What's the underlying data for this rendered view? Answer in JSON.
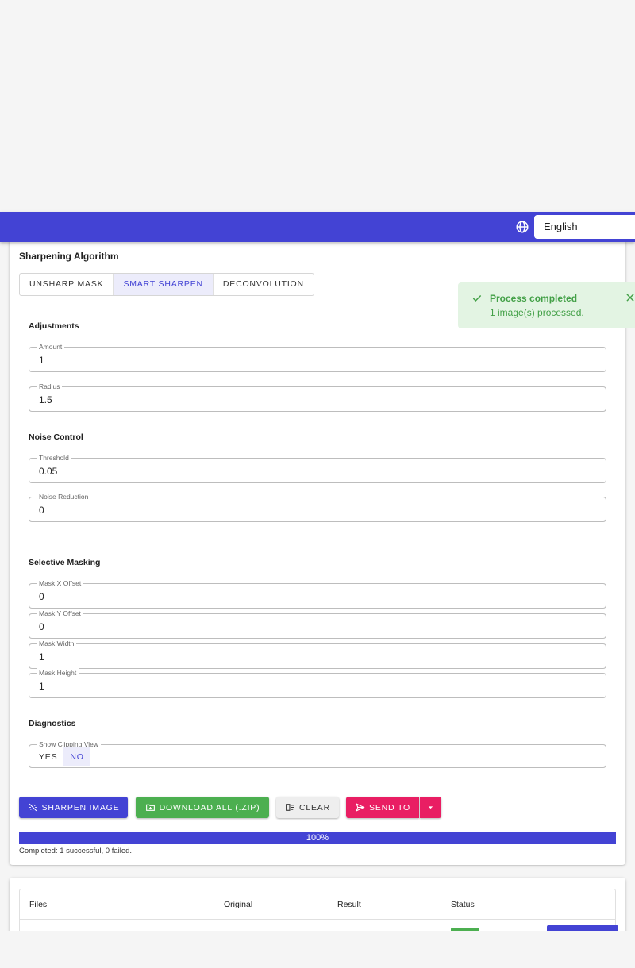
{
  "header": {
    "language": "English",
    "icon": "globe-icon"
  },
  "sharpening": {
    "title": "Sharpening Algorithm",
    "tabs": [
      "UNSHARP MASK",
      "SMART SHARPEN",
      "DECONVOLUTION"
    ],
    "selected_tab": "SMART SHARPEN"
  },
  "adjustments": {
    "title": "Adjustments",
    "amount_label": "Amount",
    "amount_value": "1",
    "radius_label": "Radius",
    "radius_value": "1.5"
  },
  "noise": {
    "title": "Noise Control",
    "threshold_label": "Threshold",
    "threshold_value": "0.05",
    "reduction_label": "Noise Reduction",
    "reduction_value": "0"
  },
  "masking": {
    "title": "Selective Masking",
    "x_label": "Mask X Offset",
    "x_value": "0",
    "y_label": "Mask Y Offset",
    "y_value": "0",
    "width_label": "Mask Width",
    "width_value": "1",
    "height_label": "Mask Height",
    "height_value": "1"
  },
  "diagnostics": {
    "title": "Diagnostics",
    "clipping_label": "Show Clipping View",
    "yes": "YES",
    "no": "NO",
    "selected": "NO"
  },
  "actions": {
    "sharpen": "SHARPEN IMAGE",
    "download": "DOWNLOAD ALL (.ZIP)",
    "clear": "CLEAR",
    "send": "SEND TO"
  },
  "progress": {
    "value": 100,
    "label": "100%",
    "summary": "Completed: 1 successful, 0 failed."
  },
  "files_table": {
    "columns": [
      "Files",
      "Original",
      "Result",
      "Status"
    ]
  },
  "toast": {
    "title": "Process completed",
    "message": "1 image(s) processed."
  },
  "colors": {
    "primary": "#4343d4",
    "success": "#4caf50",
    "accent": "#e91e63",
    "toast_bg": "#e3f4e3"
  }
}
